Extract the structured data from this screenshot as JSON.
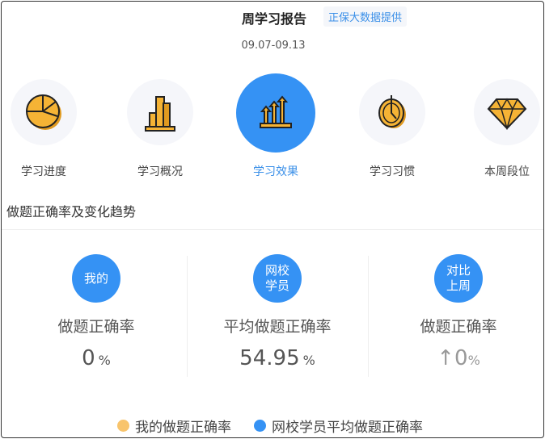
{
  "header": {
    "title": "周学习报告",
    "badge": "正保大数据提供",
    "date_range": "09.07-09.13"
  },
  "nav": [
    {
      "label": "学习进度",
      "icon": "pie-chart-icon",
      "active": false
    },
    {
      "label": "学习概况",
      "icon": "bar-chart-icon",
      "active": false
    },
    {
      "label": "学习效果",
      "icon": "rising-arrows-icon",
      "active": true
    },
    {
      "label": "学习习惯",
      "icon": "clock-icon",
      "active": false
    },
    {
      "label": "本周段位",
      "icon": "diamond-icon",
      "active": false
    }
  ],
  "section_title": "做题正确率及变化趋势",
  "stats": [
    {
      "bubble_line1": "我的",
      "bubble_line2": "",
      "label": "做题正确率",
      "value": "0",
      "unit": "%"
    },
    {
      "bubble_line1": "网校",
      "bubble_line2": "学员",
      "label": "平均做题正确率",
      "value": "54.95",
      "unit": "%"
    },
    {
      "bubble_line1": "对比",
      "bubble_line2": "上周",
      "label": "做题正确率",
      "value": "↑0",
      "unit": "%"
    }
  ],
  "legend": [
    {
      "label": "我的做题正确率",
      "color": "#f8c46c"
    },
    {
      "label": "网校学员平均做题正确率",
      "color": "#3592f4"
    }
  ],
  "colors": {
    "accent": "#3592f4",
    "icon": "#f5b335"
  }
}
